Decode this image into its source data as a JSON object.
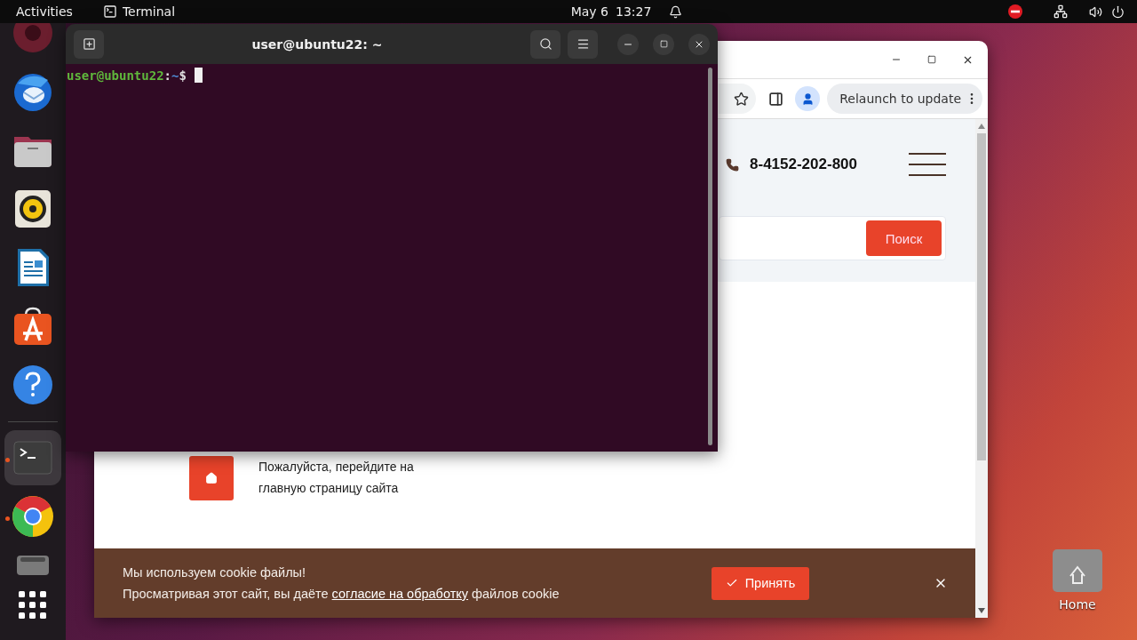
{
  "top_bar": {
    "activities": "Activities",
    "app_name": "Terminal",
    "date": "May 6",
    "time": "13:27"
  },
  "dock": {
    "pinned": [
      {
        "kind": "disc",
        "running": false,
        "selected": false
      },
      {
        "kind": "mail",
        "running": false,
        "selected": false
      },
      {
        "kind": "files",
        "running": false,
        "selected": false
      },
      {
        "kind": "speaker",
        "running": false,
        "selected": false
      },
      {
        "kind": "document",
        "running": false,
        "selected": false
      },
      {
        "kind": "store",
        "running": false,
        "selected": false
      },
      {
        "kind": "help",
        "running": false,
        "selected": false
      }
    ],
    "extra": [
      {
        "kind": "terminal",
        "running": true,
        "selected": true
      },
      {
        "kind": "browser",
        "running": true,
        "selected": false
      },
      {
        "kind": "drive",
        "running": false,
        "selected": false
      },
      {
        "kind": "app-grid",
        "running": false,
        "selected": false
      }
    ]
  },
  "terminal": {
    "title": "user@ubuntu22: ~",
    "prompt_user": "user@ubuntu22",
    "prompt_sep": ":",
    "prompt_path": "~",
    "prompt_sign": "$"
  },
  "browser": {
    "relaunch": "Relaunch to update",
    "page": {
      "phone": "8-4152-202-800",
      "search_button": "Поиск",
      "notice": "Пожалуйста, перейдите на главную страницу сайта",
      "cookie": {
        "title": "Мы используем cookie файлы!",
        "text_before": "Просматривая этот сайт, вы даёте ",
        "link": "согласие на обработку",
        "text_after": " файлов cookie",
        "accept": "Принять"
      }
    }
  },
  "desktop_icons": [
    {
      "label": "Home"
    }
  ]
}
